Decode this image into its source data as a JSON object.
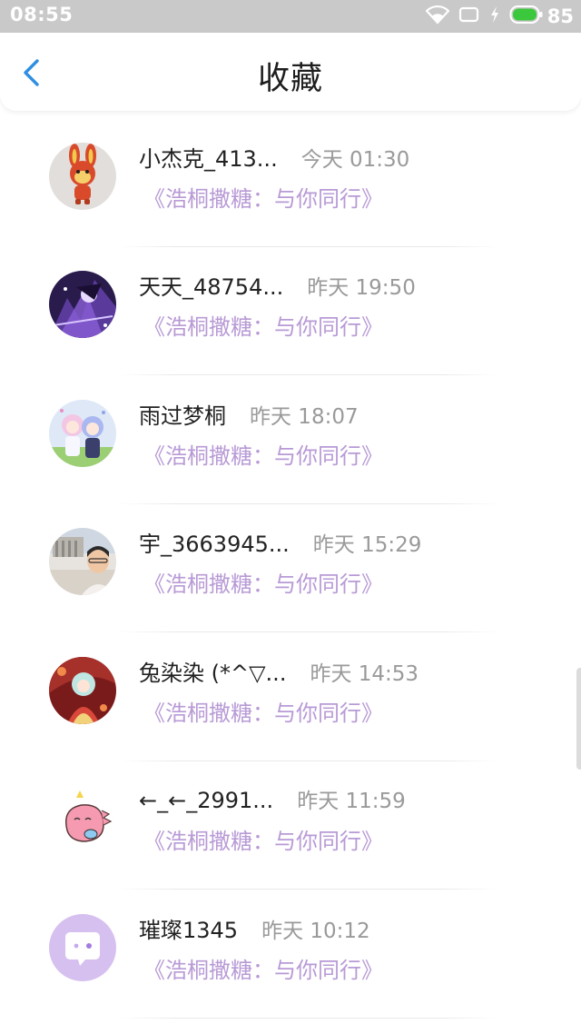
{
  "status_bar": {
    "time": "08:55",
    "battery": "85",
    "icons": [
      "wifi-icon",
      "screen-icon",
      "charging-icon",
      "battery-icon"
    ]
  },
  "header": {
    "title": "收藏",
    "back_icon": "chevron-left-icon"
  },
  "colors": {
    "accent": "#2f8fe0",
    "song_text": "#b89ad6",
    "timestamp": "#9a9a9a",
    "battery": "#3cc83c",
    "status_bar": "#c9c9c9"
  },
  "favorites": [
    {
      "user": "小杰克_413...",
      "time": "今天 01:30",
      "song": "《浩桐撒糖：与你同行》",
      "avatar": "rabbit-avatar"
    },
    {
      "user": "天天_48754...",
      "time": "昨天 19:50",
      "song": "《浩桐撒糖：与你同行》",
      "avatar": "purple-anime-avatar"
    },
    {
      "user": "雨过梦桐",
      "time": "昨天 18:07",
      "song": "《浩桐撒糖：与你同行》",
      "avatar": "anime-pair-avatar"
    },
    {
      "user": "宇_3663945...",
      "time": "昨天 15:29",
      "song": "《浩桐撒糖：与你同行》",
      "avatar": "man-photo-avatar"
    },
    {
      "user": "兔染染 (*^▽...",
      "time": "昨天 14:53",
      "song": "《浩桐撒糖：与你同行》",
      "avatar": "red-anime-avatar"
    },
    {
      "user": "←_←_2991...",
      "time": "昨天 11:59",
      "song": "《浩桐撒糖：与你同行》",
      "avatar": "pink-dino-avatar"
    },
    {
      "user": "璀璨1345",
      "time": "昨天 10:12",
      "song": "《浩桐撒糖：与你同行》",
      "avatar": "chat-bubble-avatar"
    }
  ]
}
